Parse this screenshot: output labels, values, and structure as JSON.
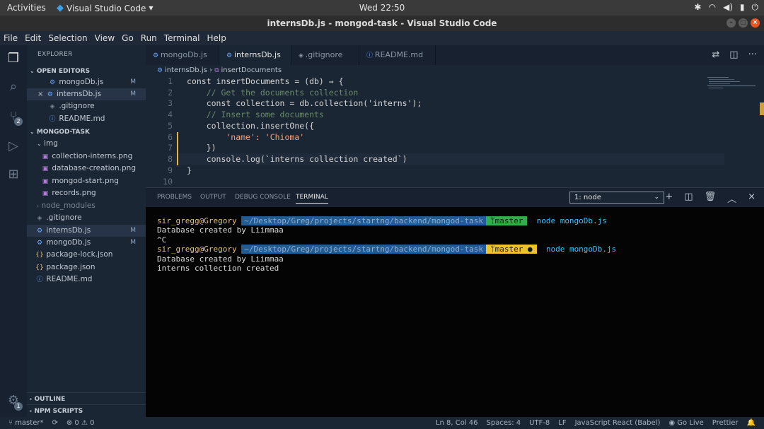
{
  "topbar": {
    "activities": "Activities",
    "app_name": "Visual Studio Code",
    "clock": "Wed 22:50"
  },
  "window": {
    "title": "internsDb.js - mongod-task - Visual Studio Code"
  },
  "menu": [
    "File",
    "Edit",
    "Selection",
    "View",
    "Go",
    "Run",
    "Terminal",
    "Help"
  ],
  "activity_bar": {
    "scm_badge": "2",
    "settings_badge": "1"
  },
  "explorer": {
    "title": "EXPLORER",
    "open_editors_label": "OPEN EDITORS",
    "open_editors": [
      {
        "name": "mongoDb.js",
        "status": "M"
      },
      {
        "name": "internsDb.js",
        "status": "M"
      },
      {
        "name": ".gitignore",
        "status": ""
      },
      {
        "name": "README.md",
        "status": ""
      }
    ],
    "project_label": "MONGOD-TASK",
    "folder_img": "img",
    "img_files": [
      "collection-interns.png",
      "database-creation.png",
      "mongod-start.png",
      "records.png"
    ],
    "node_modules": "node_modules",
    "root_files": [
      {
        "name": ".gitignore",
        "status": ""
      },
      {
        "name": "internsDb.js",
        "status": "M"
      },
      {
        "name": "mongoDb.js",
        "status": "M"
      },
      {
        "name": "package-lock.json",
        "status": ""
      },
      {
        "name": "package.json",
        "status": ""
      },
      {
        "name": "README.md",
        "status": ""
      }
    ],
    "outline_label": "OUTLINE",
    "npm_label": "NPM SCRIPTS"
  },
  "tabs": [
    {
      "label": "mongoDb.js"
    },
    {
      "label": "internsDb.js"
    },
    {
      "label": ".gitignore"
    },
    {
      "label": "README.md"
    }
  ],
  "breadcrumb": {
    "file": "internsDb.js",
    "symbol": "insertDocuments"
  },
  "code_lines": [
    {
      "n": "1",
      "text": "const insertDocuments = (db) ⇒ {"
    },
    {
      "n": "2",
      "text": "    // Get the documents collection"
    },
    {
      "n": "3",
      "text": "    const collection = db.collection('interns');"
    },
    {
      "n": "4",
      "text": "    // Insert some documents"
    },
    {
      "n": "5",
      "text": "    collection.insertOne({"
    },
    {
      "n": "6",
      "text": "        'name': 'Chioma'"
    },
    {
      "n": "7",
      "text": "    })"
    },
    {
      "n": "8",
      "text": "    console.log(`interns collection created`)"
    },
    {
      "n": "9",
      "text": "}"
    },
    {
      "n": "10",
      "text": ""
    }
  ],
  "panel": {
    "tabs": [
      "PROBLEMS",
      "OUTPUT",
      "DEBUG CONSOLE",
      "TERMINAL"
    ],
    "terminal_select": "1: node"
  },
  "terminal": {
    "prompt_user": "sir_gregg@Gregory",
    "prompt_path": "~/Desktop/Greg/projects/startng/backend/mongod-task",
    "branch_clean": "ᛘmaster",
    "branch_dirty": "ᛘmaster ●",
    "command": "node mongoDb.js",
    "out1": "Database created by Liimmaa",
    "out2": "^C",
    "out3": "Database created by Liimmaa",
    "out4": "interns collection created"
  },
  "status": {
    "branch": "master*",
    "errors": "⊗ 0 ⚠ 0",
    "position": "Ln 8, Col 46",
    "spaces": "Spaces: 4",
    "encoding": "UTF-8",
    "eol": "LF",
    "language": "JavaScript React (Babel)",
    "golive": "Go Live",
    "prettier": "Prettier"
  }
}
